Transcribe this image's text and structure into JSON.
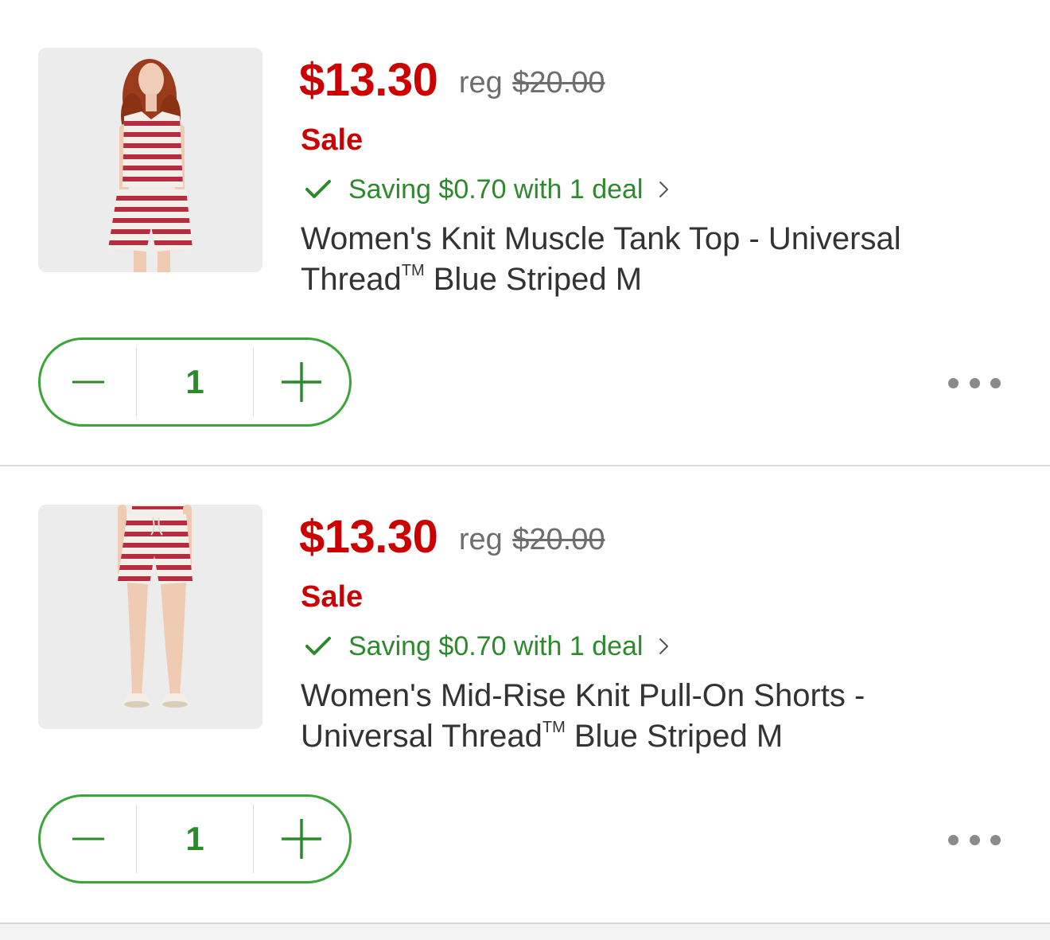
{
  "items": [
    {
      "sale_price": "$13.30",
      "reg_label": "reg",
      "reg_price": "$20.00",
      "sale_label": "Sale",
      "deal_text": "Saving $0.70 with 1 deal",
      "title_line1": "Women's Knit Muscle Tank Top - Universal",
      "title_line2_prefix": "Thread",
      "trademark": "TM",
      "title_line2_suffix": " Blue Striped M",
      "quantity": "1",
      "image_icon": "striped-tank-top-photo"
    },
    {
      "sale_price": "$13.30",
      "reg_label": "reg",
      "reg_price": "$20.00",
      "sale_label": "Sale",
      "deal_text": "Saving $0.70 with 1 deal",
      "title_line1": "Women's Mid-Rise Knit Pull-On Shorts -",
      "title_line2_prefix": "Universal Thread",
      "trademark": "TM",
      "title_line2_suffix": " Blue Striped M",
      "quantity": "1",
      "image_icon": "striped-shorts-photo"
    }
  ],
  "colors": {
    "sale_red": "#cc0000",
    "deal_green": "#2c8a2c",
    "stepper_border": "#3aa63a",
    "text_dark": "#333333",
    "text_muted": "#6d6d6d"
  },
  "icons": {
    "deal_check": "check-icon",
    "deal_chevron": "chevron-right-icon",
    "decrement": "minus-icon",
    "increment": "plus-icon",
    "more": "more-horizontal-icon"
  }
}
